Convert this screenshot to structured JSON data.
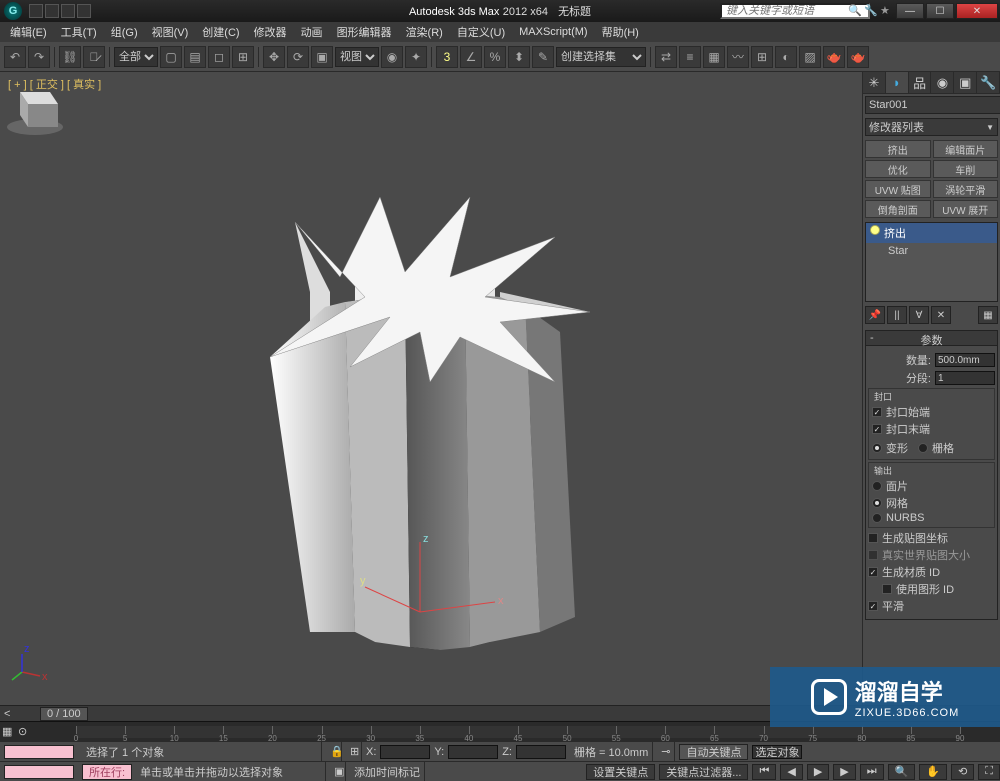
{
  "title": {
    "app": "Autodesk 3ds Max",
    "ver": "2012 x64",
    "doc": "无标题"
  },
  "search_placeholder": "键入关键字或短语",
  "menus": [
    "编辑(E)",
    "工具(T)",
    "组(G)",
    "视图(V)",
    "创建(C)",
    "修改器",
    "动画",
    "图形编辑器",
    "渲染(R)",
    "自定义(U)",
    "MAXScript(M)",
    "帮助(H)"
  ],
  "toolbar": {
    "scope": "全部",
    "viewmode": "视图",
    "sel_set": "创建选择集"
  },
  "viewport_label": "[ + ] [ 正交 ] [ 真实 ]",
  "cmd": {
    "object_name": "Star001",
    "modlist_label": "修改器列表",
    "grid_buttons": [
      "挤出",
      "编辑面片",
      "优化",
      "车削",
      "UVW 贴图",
      "涡轮平滑",
      "倒角剖面",
      "UVW 展开"
    ],
    "stack": {
      "items": [
        "挤出",
        "Star"
      ],
      "selected_index": 0
    },
    "rollout_title": "参数",
    "params": {
      "amount_label": "数量:",
      "amount_value": "500.0mm",
      "segments_label": "分段:",
      "segments_value": "1",
      "cap_group": "封口",
      "cap_start": "封口始端",
      "cap_end": "封口末端",
      "morph": "变形",
      "grid": "栅格",
      "out_group": "输出",
      "patch": "面片",
      "mesh": "网格",
      "nurbs": "NURBS",
      "gen_map": "生成贴图坐标",
      "real_world": "真实世界贴图大小",
      "gen_mat": "生成材质 ID",
      "use_shape": "使用图形 ID",
      "smooth": "平滑"
    }
  },
  "time": {
    "pos": "0 / 100",
    "ticks": [
      0,
      5,
      10,
      15,
      20,
      25,
      30,
      35,
      40,
      45,
      50,
      55,
      60,
      65,
      70,
      75,
      80,
      85,
      90
    ]
  },
  "status": {
    "sel": "选择了 1 个对象",
    "hint": "单击或单击并拖动以选择对象",
    "x_label": "X:",
    "y_label": "Y:",
    "z_label": "Z:",
    "grid": "栅格 = 10.0mm",
    "autokey": "自动关键点",
    "selset": "选定对象",
    "row_label": "所在行:",
    "add_time": "添加时间标记",
    "setkey": "设置关键点",
    "keyfilter": "关键点过滤器..."
  },
  "watermark": {
    "brand": "溜溜自学",
    "url": "ZIXUE.3D66.COM"
  }
}
